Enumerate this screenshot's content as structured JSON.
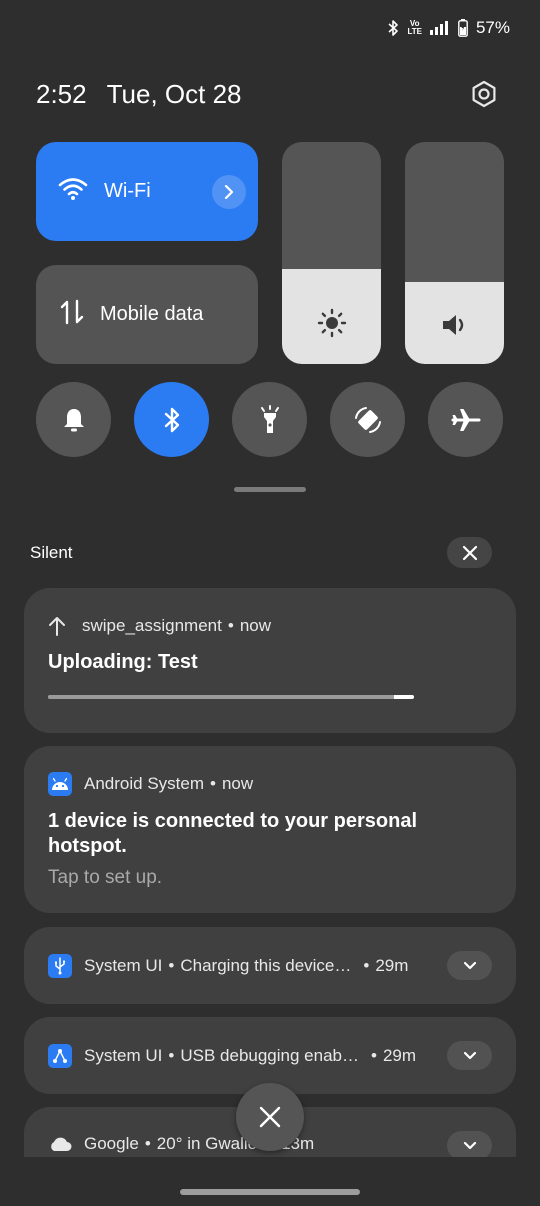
{
  "status_bar": {
    "bluetooth_icon": "bluetooth-icon",
    "volte_top": "Vo",
    "volte_bottom": "LTE",
    "signal_icon": "signal-bars-icon",
    "battery_icon": "battery-charging-icon",
    "battery_percent": "57%"
  },
  "header": {
    "time": "2:52",
    "date": "Tue, Oct 28",
    "settings_icon": "gear-icon"
  },
  "quick_settings": {
    "wifi": {
      "label": "Wi-Fi",
      "icon": "wifi-icon",
      "active": true
    },
    "mobile_data": {
      "label": "Mobile data",
      "icon": "data-arrows-icon",
      "active": false
    },
    "brightness_level": 0.43,
    "volume_level": 0.37,
    "toggles": [
      {
        "name": "sound",
        "icon": "bell-icon",
        "active": false
      },
      {
        "name": "bluetooth",
        "icon": "bluetooth-icon",
        "active": true
      },
      {
        "name": "flashlight",
        "icon": "flashlight-icon",
        "active": false
      },
      {
        "name": "auto-rotate",
        "icon": "rotate-icon",
        "active": false
      },
      {
        "name": "airplane-mode",
        "icon": "airplane-icon",
        "active": false
      }
    ]
  },
  "notifications": {
    "section_label": "Silent",
    "items": [
      {
        "app": "swipe_assignment",
        "time": "now",
        "title": "Uploading: Test",
        "progress": 0.95
      },
      {
        "app": "Android System",
        "time": "now",
        "title_line1": "1 device is connected to your personal",
        "title_line2": "hotspot.",
        "subtitle": "Tap to set up."
      },
      {
        "app": "System UI",
        "summary": "Charging this device…",
        "time": "29m"
      },
      {
        "app": "System UI",
        "summary": "USB debugging enab…",
        "time": "29m"
      },
      {
        "app": "Google",
        "summary": "20° in Gwalio",
        "time": "13m"
      }
    ]
  },
  "colors": {
    "accent": "#2b7bf3",
    "background": "#2e2e2e",
    "card": "#404040",
    "tile_inactive": "#555555"
  }
}
